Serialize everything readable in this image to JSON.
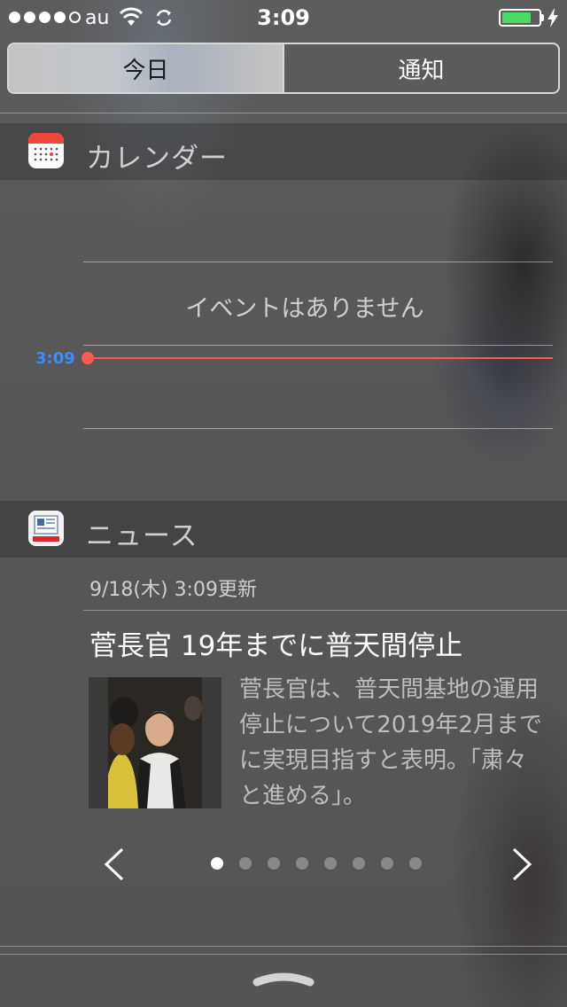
{
  "status_bar": {
    "carrier": "au",
    "time": "3:09",
    "signal_bars_filled": 4,
    "signal_bars_total": 5,
    "battery_level": 0.8,
    "battery_color": "#4cd964"
  },
  "segmented_control": {
    "tabs": [
      {
        "label": "今日",
        "selected": true
      },
      {
        "label": "通知",
        "selected": false
      }
    ]
  },
  "calendar": {
    "title": "カレンダー",
    "icon": "calendar-app-icon",
    "empty_message": "イベントはありません",
    "current_time_label": "3:09",
    "now_color": "#ff5a50",
    "time_label_color": "#3d8bfd"
  },
  "news": {
    "title": "ニュース",
    "icon": "yahoo-news-app-icon",
    "updated": "9/18(木) 3:09更新",
    "headline": "菅長官 19年までに普天間停止",
    "body": "菅長官は、普天間基地の運用停止について2019年2月までに実現目指すと表明。「粛々と進める」。",
    "page_count": 8,
    "current_page": 1,
    "prev_icon": "chevron-left-icon",
    "next_icon": "chevron-right-icon"
  },
  "footer": {
    "grabber_icon": "grabber-handle-icon"
  }
}
